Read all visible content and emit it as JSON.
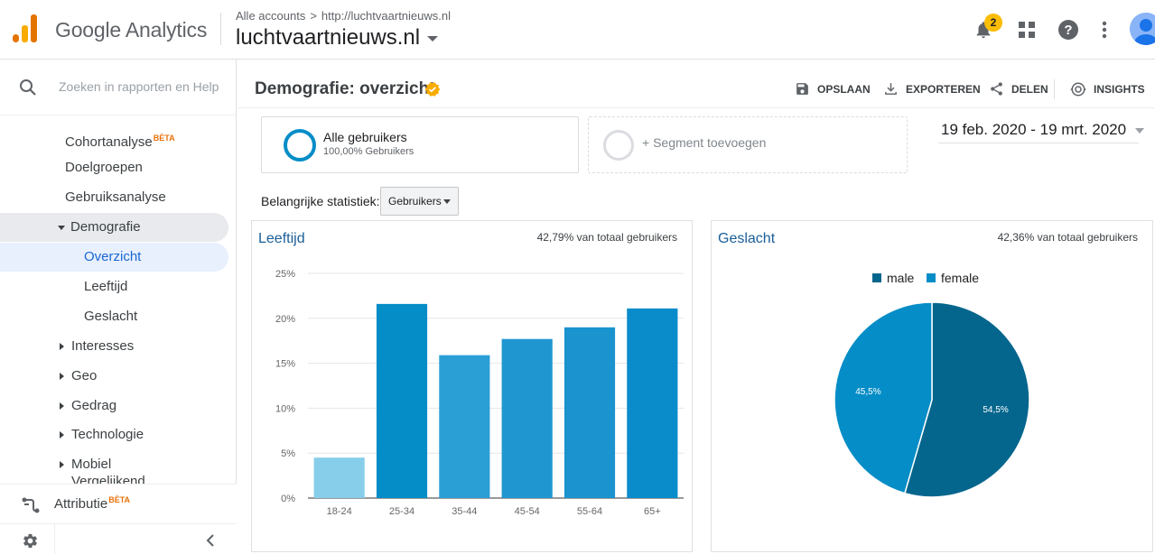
{
  "header": {
    "brand": "Google Analytics",
    "breadcrumb_account": "Alle accounts",
    "breadcrumb_separator": ">",
    "breadcrumb_property": "http://luchtvaartnieuws.nl",
    "property_name": "luchtvaartnieuws.nl",
    "notification_count": "2",
    "icons": [
      "bell-icon",
      "apps-grid-icon",
      "help-icon",
      "more-vert-icon",
      "avatar"
    ]
  },
  "sidebar": {
    "search_placeholder": "Zoeken in rapporten en Help",
    "items": [
      {
        "label": "Cohortanalyse",
        "badge": "BÈTA"
      },
      {
        "label": "Doelgroepen"
      },
      {
        "label": "Gebruiksanalyse"
      },
      {
        "label": "Demografie"
      },
      {
        "label": "Overzicht"
      },
      {
        "label": "Leeftijd"
      },
      {
        "label": "Geslacht"
      },
      {
        "label": "Interesses"
      },
      {
        "label": "Geo"
      },
      {
        "label": "Gedrag"
      },
      {
        "label": "Technologie"
      },
      {
        "label": "Mobiel"
      },
      {
        "label": "Vergelijkend"
      }
    ],
    "attribution_label": "Attributie",
    "attribution_badge": "BÈTA"
  },
  "main": {
    "title": "Demografie: overzicht",
    "actions": {
      "save": "OPSLAAN",
      "export": "EXPORTEREN",
      "share": "DELEN",
      "insights": "INSIGHTS"
    },
    "segment": {
      "name": "Alle gebruikers",
      "detail": "100,00% Gebruikers",
      "add_label": "+ Segment toevoegen"
    },
    "date_range": "19 feb. 2020 - 19 mrt. 2020",
    "metric_label": "Belangrijke statistiek:",
    "metric_value": "Gebruikers",
    "age_card": {
      "title": "Leeftijd",
      "subtitle": "42,79% van totaal gebruikers"
    },
    "gender_card": {
      "title": "Geslacht",
      "subtitle": "42,36% van totaal gebruikers",
      "legend": [
        {
          "label": "male",
          "color": "#05668d"
        },
        {
          "label": "female",
          "color": "#058dc7"
        }
      ]
    }
  },
  "chart_data": [
    {
      "type": "bar",
      "title": "Leeftijd",
      "categories": [
        "18-24",
        "25-34",
        "35-44",
        "45-54",
        "55-64",
        "65+"
      ],
      "values": [
        4.5,
        21.6,
        15.9,
        17.7,
        19.0,
        21.1
      ],
      "colors": [
        "#87ceeb",
        "#058dc7",
        "#2a9fd6",
        "#1f96d0",
        "#1a93cf",
        "#0a8ccb"
      ],
      "ylim": [
        0,
        25
      ],
      "yticks": [
        "0%",
        "5%",
        "10%",
        "15%",
        "20%",
        "25%"
      ],
      "grid": true
    },
    {
      "type": "pie",
      "title": "Geslacht",
      "slices": [
        {
          "label": "male",
          "value": 54.5,
          "display": "54,5%",
          "color": "#05668d"
        },
        {
          "label": "female",
          "value": 45.5,
          "display": "45,5%",
          "color": "#058dc7"
        }
      ],
      "legend": "top"
    }
  ]
}
